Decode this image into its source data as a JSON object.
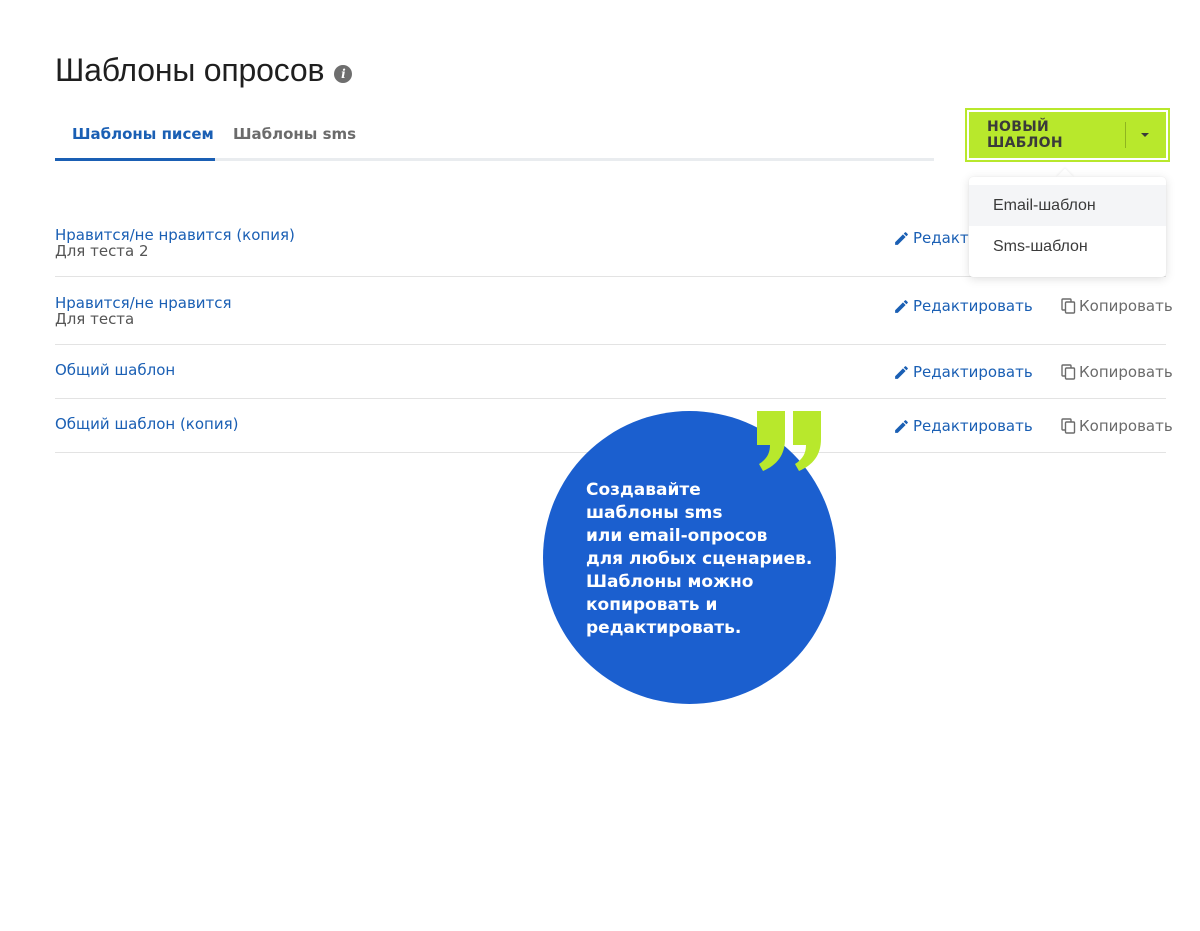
{
  "page": {
    "title": "Шаблоны опросов"
  },
  "tabs": [
    {
      "label": "Шаблоны писем",
      "active": true
    },
    {
      "label": "Шаблоны sms",
      "active": false
    }
  ],
  "new_template_button": {
    "label": "НОВЫЙ ШАБЛОН",
    "color": "#b8e82c"
  },
  "dropdown": {
    "items": [
      "Email-шаблон",
      "Sms-шаблон"
    ]
  },
  "templates": [
    {
      "title": "Нравится/не нравится (копия)",
      "subtitle": "Для теста 2",
      "edit_label": "Редактировать"
    },
    {
      "title": "Нравится/не нравится",
      "subtitle": "Для теста",
      "edit_label": "Редактировать",
      "copy_label": "Копировать"
    },
    {
      "title": "Общий шаблон",
      "edit_label": "Редактировать",
      "copy_label": "Копировать"
    },
    {
      "title": "Общий шаблон (копия)",
      "edit_label": "Редактировать",
      "copy_label": "Копировать"
    }
  ],
  "callout": {
    "text": "Создавайте\nшаблоны sms\nили email-опросов\nдля любых сценариев.\nШаблоны можно\nкопировать и\nредактировать.",
    "circle_color": "#1b5fcf",
    "quote_color": "#b8e82c"
  },
  "colors": {
    "link": "#1a5fb4",
    "muted": "#6b6b6b"
  }
}
